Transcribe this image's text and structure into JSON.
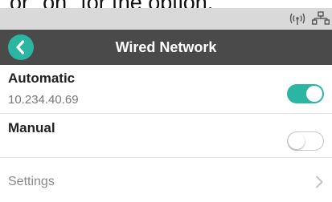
{
  "caption_fragment": "or \"on\" for the option.",
  "status_bar": {
    "icons": [
      "wifi-signal-icon",
      "wired-network-icon"
    ],
    "background": "#d9d9d9"
  },
  "header": {
    "title": "Wired Network",
    "back_icon": "chevron-left-icon",
    "background": "#4a4a4a",
    "accent": "#2bb5a3"
  },
  "options": {
    "automatic": {
      "label": "Automatic",
      "ip_address": "10.234.40.69",
      "enabled": true
    },
    "manual": {
      "label": "Manual",
      "enabled": false
    }
  },
  "settings": {
    "label": "Settings",
    "icon": "chevron-right-icon"
  }
}
